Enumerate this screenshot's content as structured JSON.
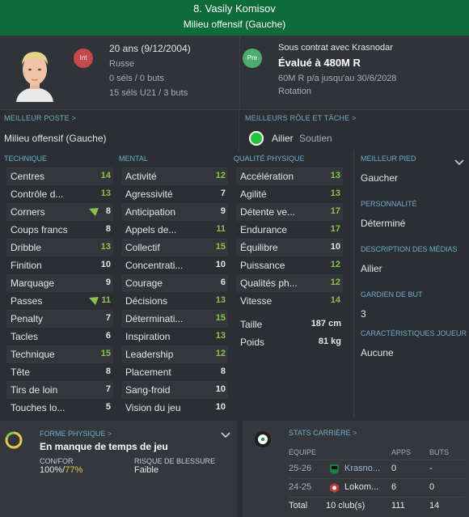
{
  "header": {
    "name": "8. Vasily Komisov",
    "role": "Milieu offensif (Gauche)"
  },
  "info": {
    "age": "20 ans (9/12/2004)",
    "nationality": "Russe",
    "caps": "0 séls / 0 buts",
    "u21": "15 séls U21 / 3 buts",
    "badge_int": "Int",
    "badge_pre": "Pre",
    "contract": "Sous contrat avec Krasnodar",
    "value": "Évalué à 480M R",
    "wage": "60M R p/a jusqu'au 30/6/2028",
    "rotation": "Rotation"
  },
  "best_position": {
    "label": "MEILLEUR POSTE >",
    "value": "Milieu offensif (Gauche)"
  },
  "best_role": {
    "label": "MEILLEURS RÔLE ET TÂCHE >",
    "role": "Ailier",
    "duty": "Soutien"
  },
  "sections": {
    "technical": "TECHNIQUE",
    "mental": "MENTAL",
    "physical": "QUALITÉ PHYSIQUE"
  },
  "technical": [
    {
      "n": "Centres",
      "v": "14",
      "hl": true
    },
    {
      "n": "Contrôle d...",
      "v": "13",
      "hl": true
    },
    {
      "n": "Corners",
      "v": "8",
      "hl": false
    },
    {
      "n": "Coups francs",
      "v": "8",
      "hl": false
    },
    {
      "n": "Dribble",
      "v": "13",
      "hl": true
    },
    {
      "n": "Finition",
      "v": "10",
      "hl": false
    },
    {
      "n": "Marquage",
      "v": "9",
      "hl": false
    },
    {
      "n": "Passes",
      "v": "11",
      "hl": true
    },
    {
      "n": "Penalty",
      "v": "7",
      "hl": false
    },
    {
      "n": "Tacles",
      "v": "6",
      "hl": false
    },
    {
      "n": "Technique",
      "v": "15",
      "hl": true
    },
    {
      "n": "Tête",
      "v": "8",
      "hl": false
    },
    {
      "n": "Tirs de loin",
      "v": "7",
      "hl": false
    },
    {
      "n": "Touches lo...",
      "v": "5",
      "hl": false
    }
  ],
  "mental": [
    {
      "n": "Activité",
      "v": "12",
      "hl": true
    },
    {
      "n": "Agressivité",
      "v": "7",
      "hl": false
    },
    {
      "n": "Anticipation",
      "v": "9",
      "hl": false
    },
    {
      "n": "Appels de...",
      "v": "11",
      "hl": true
    },
    {
      "n": "Collectif",
      "v": "15",
      "hl": true
    },
    {
      "n": "Concentrati...",
      "v": "10",
      "hl": false
    },
    {
      "n": "Courage",
      "v": "6",
      "hl": false
    },
    {
      "n": "Décisions",
      "v": "13",
      "hl": true
    },
    {
      "n": "Déterminati...",
      "v": "15",
      "hl": true
    },
    {
      "n": "Inspiration",
      "v": "13",
      "hl": true
    },
    {
      "n": "Leadership",
      "v": "12",
      "hl": true
    },
    {
      "n": "Placement",
      "v": "8",
      "hl": false
    },
    {
      "n": "Sang-froid",
      "v": "10",
      "hl": false
    },
    {
      "n": "Vision du jeu",
      "v": "10",
      "hl": false
    }
  ],
  "physical": [
    {
      "n": "Accélération",
      "v": "13",
      "hl": true
    },
    {
      "n": "Agilité",
      "v": "13",
      "hl": true
    },
    {
      "n": "Détente ve...",
      "v": "17",
      "hl": true
    },
    {
      "n": "Endurance",
      "v": "17",
      "hl": true
    },
    {
      "n": "Équilibre",
      "v": "10",
      "hl": false
    },
    {
      "n": "Puissance",
      "v": "12",
      "hl": true
    },
    {
      "n": "Qualités ph...",
      "v": "12",
      "hl": true
    },
    {
      "n": "Vitesse",
      "v": "14",
      "hl": true
    }
  ],
  "physical_extra": {
    "height_label": "Taille",
    "height": "187 cm",
    "weight_label": "Poids",
    "weight": "81 kg"
  },
  "right_panel": {
    "best_foot_label": "MEILLEUR PIED",
    "best_foot": "Gaucher",
    "personality_label": "PERSONNALITÉ",
    "personality": "Déterminé",
    "media_label": "DESCRIPTION DES MÉDIAS",
    "media": "Ailier",
    "gk_label": "GARDIEN DE BUT",
    "gk": "3",
    "traits_label": "CARACTÉRISTIQUES JOUEUR",
    "traits": "Aucune"
  },
  "fitness": {
    "label": "FORME PHYSIQUE >",
    "status": "En manque de temps de jeu",
    "conf_label": "CON/FOR",
    "conf_a": "100%",
    "conf_sep": "/",
    "conf_b": "77%",
    "injury_label": "RISQUE DE BLESSURE",
    "injury": "Faible"
  },
  "career": {
    "label": "STATS CARRIÈRE >",
    "headers": {
      "team": "ÉQUIPE",
      "apps": "APPS",
      "goals": "BUTS"
    },
    "rows": [
      {
        "season": "25-26",
        "club": "Krasno...",
        "apps": "0",
        "goals": "-"
      },
      {
        "season": "24-25",
        "club": "Lokom...",
        "apps": "6",
        "goals": "0"
      }
    ],
    "total": {
      "label": "Total",
      "clubs": "10 club(s)",
      "apps": "111",
      "goals": "14"
    }
  },
  "colors": {
    "header_bg": "#0e6b3a",
    "highlight": "#8bc34a",
    "label": "#6bb0c8"
  }
}
